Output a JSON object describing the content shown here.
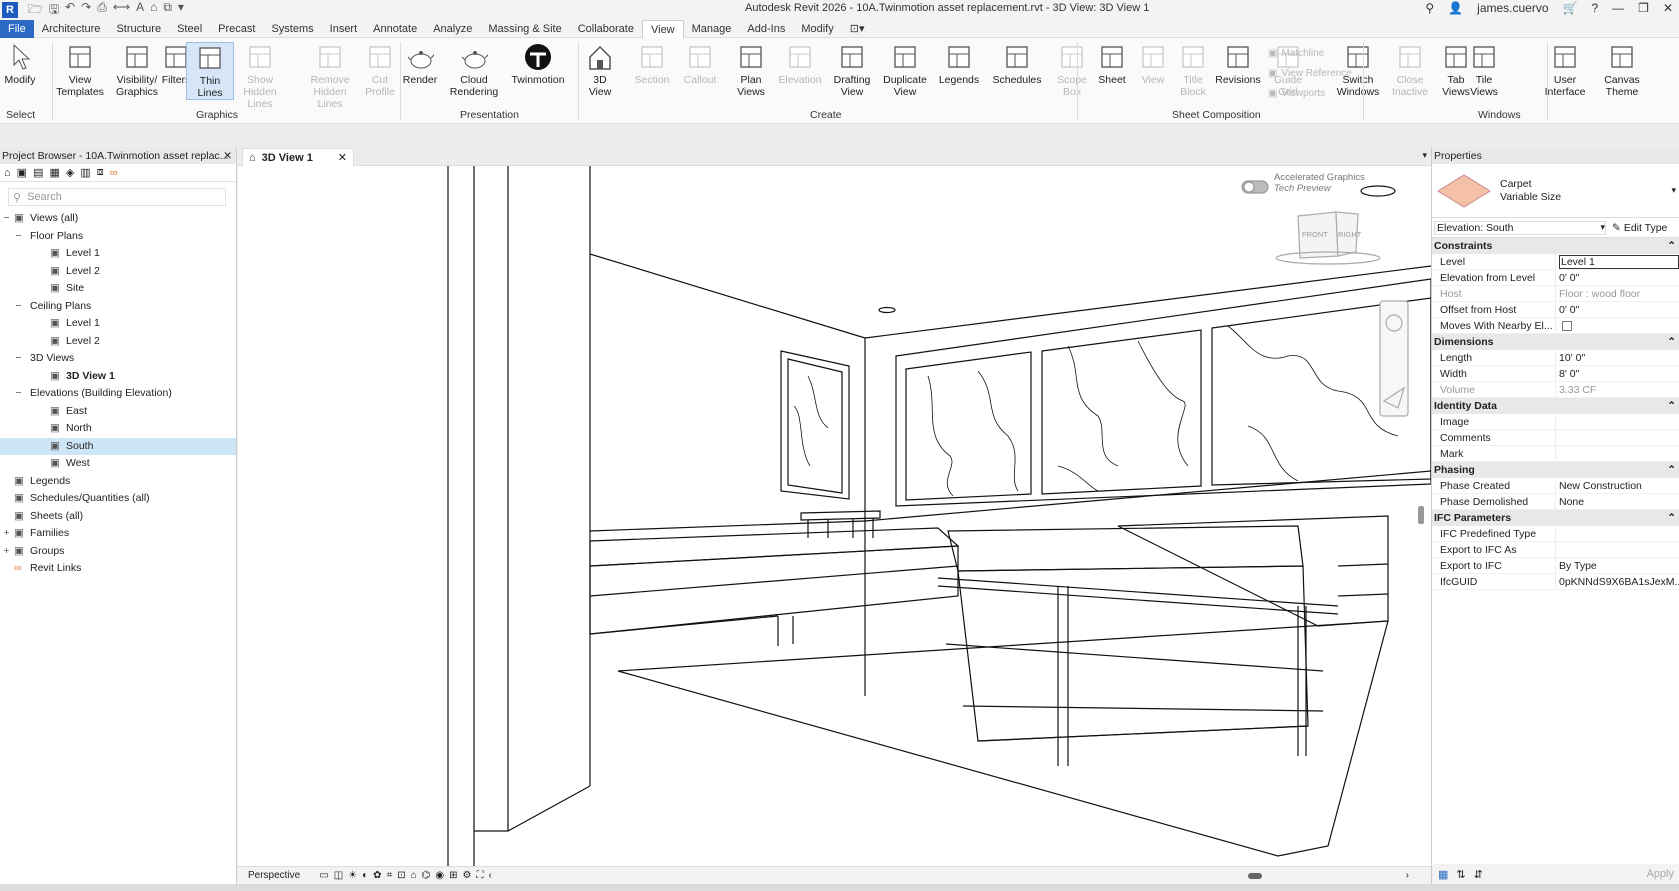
{
  "app": {
    "title": "Autodesk Revit 2026 - 10A.Twinmotion asset replacement.rvt - 3D View: 3D View 1",
    "user": "james.cuervo",
    "logo": "R"
  },
  "menu": {
    "tabs": [
      "File",
      "Architecture",
      "Structure",
      "Steel",
      "Precast",
      "Systems",
      "Insert",
      "Annotate",
      "Analyze",
      "Massing & Site",
      "Collaborate",
      "View",
      "Manage",
      "Add-Ins",
      "Modify"
    ],
    "active": "View"
  },
  "ribbon": {
    "buttons": [
      {
        "id": "modify",
        "l1": "Modify",
        "l2": "",
        "icon": "arrow-cursor-icon",
        "dis": false
      },
      {
        "id": "view-templates",
        "l1": "View",
        "l2": "Templates",
        "icon": "view-templates-icon",
        "dis": false
      },
      {
        "id": "visibility",
        "l1": "Visibility/",
        "l2": "Graphics",
        "icon": "visibility-icon",
        "dis": false
      },
      {
        "id": "filters",
        "l1": "Filters",
        "l2": "",
        "icon": "filters-icon",
        "dis": false
      },
      {
        "id": "thin-lines",
        "l1": "Thin",
        "l2": "Lines",
        "icon": "thin-lines-icon",
        "dis": false
      },
      {
        "id": "show-hidden",
        "l1": "Show",
        "l2": "Hidden Lines",
        "icon": "show-hidden-lines-icon",
        "dis": true
      },
      {
        "id": "remove-hidden",
        "l1": "Remove",
        "l2": "Hidden Lines",
        "icon": "remove-hidden-lines-icon",
        "dis": true
      },
      {
        "id": "cut-profile",
        "l1": "Cut",
        "l2": "Profile",
        "icon": "cut-profile-icon",
        "dis": true
      },
      {
        "id": "render",
        "l1": "Render",
        "l2": "",
        "icon": "teapot-icon",
        "dis": false
      },
      {
        "id": "cloud-rendering",
        "l1": "Cloud",
        "l2": "Rendering",
        "icon": "cloud-teapot-icon",
        "dis": false
      },
      {
        "id": "twinmotion",
        "l1": "Twinmotion",
        "l2": "",
        "icon": "twinmotion-icon",
        "dis": false
      },
      {
        "id": "3d-view",
        "l1": "3D",
        "l2": "View",
        "icon": "house-3d-icon",
        "dis": false
      },
      {
        "id": "section",
        "l1": "Section",
        "l2": "",
        "icon": "section-icon",
        "dis": true
      },
      {
        "id": "callout",
        "l1": "Callout",
        "l2": "",
        "icon": "callout-icon",
        "dis": true
      },
      {
        "id": "plan-views",
        "l1": "Plan",
        "l2": "Views",
        "icon": "plan-views-icon",
        "dis": false
      },
      {
        "id": "elevation",
        "l1": "Elevation",
        "l2": "",
        "icon": "elevation-icon",
        "dis": true
      },
      {
        "id": "drafting-view",
        "l1": "Drafting",
        "l2": "View",
        "icon": "drafting-view-icon",
        "dis": false
      },
      {
        "id": "duplicate-view",
        "l1": "Duplicate",
        "l2": "View",
        "icon": "duplicate-view-icon",
        "dis": false
      },
      {
        "id": "legends",
        "l1": "Legends",
        "l2": "",
        "icon": "legends-icon",
        "dis": false
      },
      {
        "id": "schedules",
        "l1": "Schedules",
        "l2": "",
        "icon": "schedules-icon",
        "dis": false
      },
      {
        "id": "scope-box",
        "l1": "Scope",
        "l2": "Box",
        "icon": "scope-box-icon",
        "dis": true
      },
      {
        "id": "sheet",
        "l1": "Sheet",
        "l2": "",
        "icon": "sheet-icon",
        "dis": false
      },
      {
        "id": "view",
        "l1": "View",
        "l2": "",
        "icon": "view-on-sheet-icon",
        "dis": true
      },
      {
        "id": "title-block",
        "l1": "Title",
        "l2": "Block",
        "icon": "title-block-icon",
        "dis": true
      },
      {
        "id": "revisions",
        "l1": "Revisions",
        "l2": "",
        "icon": "revisions-icon",
        "dis": false
      },
      {
        "id": "guide-grid",
        "l1": "Guide",
        "l2": "Grid",
        "icon": "guide-grid-icon",
        "dis": true
      },
      {
        "id": "switch-windows",
        "l1": "Switch",
        "l2": "Windows",
        "icon": "switch-windows-icon",
        "dis": false
      },
      {
        "id": "close-inactive",
        "l1": "Close",
        "l2": "Inactive",
        "icon": "close-inactive-icon",
        "dis": true
      },
      {
        "id": "tab-views",
        "l1": "Tab",
        "l2": "Views",
        "icon": "tab-views-icon",
        "dis": false
      },
      {
        "id": "tile-views",
        "l1": "Tile",
        "l2": "Views",
        "icon": "tile-views-icon",
        "dis": false
      },
      {
        "id": "user-interface",
        "l1": "User",
        "l2": "Interface",
        "icon": "user-interface-icon",
        "dis": false
      },
      {
        "id": "canvas-theme",
        "l1": "Canvas",
        "l2": "Theme",
        "icon": "canvas-theme-icon",
        "dis": false
      }
    ],
    "small": [
      "Matchline",
      "View Reference",
      "Viewports"
    ],
    "groups": [
      "Select",
      "Graphics",
      "Presentation",
      "Create",
      "Sheet Composition",
      "Windows"
    ]
  },
  "browser": {
    "title": "Project Browser - 10A.Twinmotion asset replac...",
    "search_placeholder": "Search",
    "items": [
      {
        "label": "Views (all)",
        "level": 0,
        "toggle": "−",
        "icon": "views-icon"
      },
      {
        "label": "Floor Plans",
        "level": 1,
        "toggle": "−",
        "icon": ""
      },
      {
        "label": "Level 1",
        "level": 2,
        "toggle": "",
        "icon": "view-icon"
      },
      {
        "label": "Level 2",
        "level": 2,
        "toggle": "",
        "icon": "view-icon"
      },
      {
        "label": "Site",
        "level": 2,
        "toggle": "",
        "icon": "view-icon"
      },
      {
        "label": "Ceiling Plans",
        "level": 1,
        "toggle": "−",
        "icon": ""
      },
      {
        "label": "Level 1",
        "level": 2,
        "toggle": "",
        "icon": "view-icon"
      },
      {
        "label": "Level 2",
        "level": 2,
        "toggle": "",
        "icon": "view-icon"
      },
      {
        "label": "3D Views",
        "level": 1,
        "toggle": "−",
        "icon": ""
      },
      {
        "label": "3D View 1",
        "level": 2,
        "toggle": "",
        "icon": "view-icon",
        "bold": true
      },
      {
        "label": "Elevations (Building Elevation)",
        "level": 1,
        "toggle": "−",
        "icon": ""
      },
      {
        "label": "East",
        "level": 2,
        "toggle": "",
        "icon": "view-icon"
      },
      {
        "label": "North",
        "level": 2,
        "toggle": "",
        "icon": "view-icon"
      },
      {
        "label": "South",
        "level": 2,
        "toggle": "",
        "icon": "view-icon",
        "selected": true
      },
      {
        "label": "West",
        "level": 2,
        "toggle": "",
        "icon": "view-icon"
      },
      {
        "label": "Legends",
        "level": 0,
        "toggle": "",
        "icon": "legends-icon"
      },
      {
        "label": "Schedules/Quantities (all)",
        "level": 0,
        "toggle": "",
        "icon": "schedules-icon"
      },
      {
        "label": "Sheets (all)",
        "level": 0,
        "toggle": "",
        "icon": "sheets-icon"
      },
      {
        "label": "Families",
        "level": 0,
        "toggle": "+",
        "icon": "families-icon"
      },
      {
        "label": "Groups",
        "level": 0,
        "toggle": "+",
        "icon": "groups-icon"
      },
      {
        "label": "Revit Links",
        "level": 0,
        "toggle": "",
        "icon": "links-icon"
      }
    ]
  },
  "viewport": {
    "tab_label": "3D View 1",
    "accelerated": "Accelerated Graphics",
    "tech_preview": "Tech Preview",
    "viewcube_front": "FRONT",
    "viewcube_right": "RIGHT",
    "view_mode": "Perspective"
  },
  "properties": {
    "title": "Properties",
    "type_name": "Carpet",
    "type_sub": "Variable Size",
    "filter": "Elevation: South",
    "edit_type": "Edit Type",
    "sections": [
      {
        "name": "Constraints",
        "rows": [
          {
            "k": "Level",
            "v": "Level 1",
            "input": true
          },
          {
            "k": "Elevation from Level",
            "v": "0'  0\""
          },
          {
            "k": "Host",
            "v": "Floor : wood floor",
            "ro": true
          },
          {
            "k": "Offset from Host",
            "v": "0'  0\""
          },
          {
            "k": "Moves With Nearby El...",
            "v": "",
            "check": true
          }
        ]
      },
      {
        "name": "Dimensions",
        "rows": [
          {
            "k": "Length",
            "v": "10'  0\""
          },
          {
            "k": "Width",
            "v": "8'  0\""
          },
          {
            "k": "Volume",
            "v": "3.33 CF",
            "ro": true
          }
        ]
      },
      {
        "name": "Identity Data",
        "rows": [
          {
            "k": "Image",
            "v": ""
          },
          {
            "k": "Comments",
            "v": ""
          },
          {
            "k": "Mark",
            "v": ""
          }
        ]
      },
      {
        "name": "Phasing",
        "rows": [
          {
            "k": "Phase Created",
            "v": "New Construction"
          },
          {
            "k": "Phase Demolished",
            "v": "None"
          }
        ]
      },
      {
        "name": "IFC Parameters",
        "rows": [
          {
            "k": "IFC Predefined Type",
            "v": ""
          },
          {
            "k": "Export to IFC As",
            "v": ""
          },
          {
            "k": "Export to IFC",
            "v": "By Type"
          },
          {
            "k": "IfcGUID",
            "v": "0pKNNdS9X6BA1sJexM..."
          }
        ]
      }
    ],
    "apply": "Apply"
  },
  "colors": {
    "accent": "#2a6ac4",
    "selection": "#cde6f7",
    "swatch": "#f4c0a8"
  }
}
